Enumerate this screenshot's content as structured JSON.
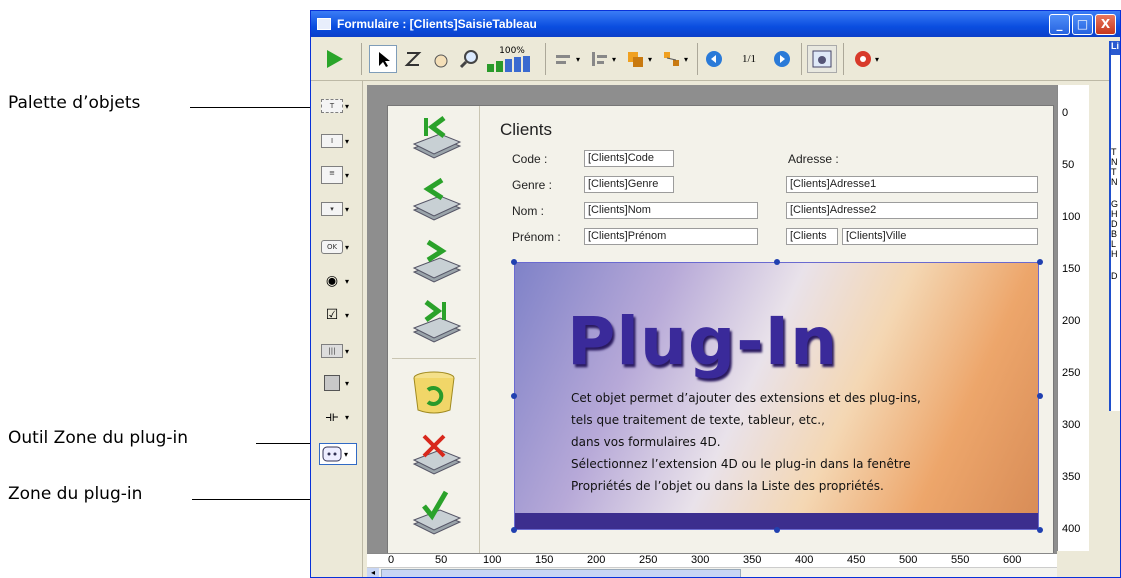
{
  "callouts": {
    "palette": "Palette d’objets",
    "outil": "Outil Zone du plug-in",
    "zone": "Zone du plug-in"
  },
  "window": {
    "title": "Formulaire : [Clients]SaisieTableau",
    "zoom_label": "100%",
    "page_counter": "1/1",
    "minimize": "_",
    "maximize": "□",
    "close": "X"
  },
  "form": {
    "title": "Clients",
    "labels": {
      "code": "Code :",
      "genre": "Genre :",
      "nom": "Nom :",
      "prenom": "Prénom :",
      "adresse": "Adresse :"
    },
    "fields": {
      "code": "[Clients]Code",
      "genre": "[Clients]Genre",
      "nom": "[Clients]Nom",
      "prenom": "[Clients]Prénom",
      "adresse1": "[Clients]Adresse1",
      "adresse2": "[Clients]Adresse2",
      "cp": "[Clients",
      "ville": "[Clients]Ville"
    }
  },
  "plugin_area": {
    "heading": "Plug-In",
    "lines": [
      "Cet objet permet d’ajouter des extensions et des plug-ins,",
      "tels que traitement de texte, tableur, etc.,",
      "dans vos formulaires 4D.",
      "Sélectionnez l’extension 4D ou le plug-in dans la fenêtre",
      "Propriétés de l’objet ou dans la Liste des propriétés."
    ]
  },
  "vruler": [
    "0",
    "50",
    "100",
    "150",
    "200",
    "250",
    "300",
    "350",
    "400"
  ],
  "hruler": [
    "0",
    "50",
    "100",
    "150",
    "200",
    "250",
    "300",
    "350",
    "400",
    "450",
    "500",
    "550",
    "600"
  ],
  "side_panel": {
    "title": "Li",
    "letters": [
      "T",
      "N",
      "T",
      "N",
      "G",
      "H",
      "D",
      "B",
      "L",
      "H",
      "D"
    ]
  },
  "colors": {
    "titlebar": "#0a4ee0",
    "window_bg": "#ece9d8",
    "canvas": "#8e8e8e",
    "plugin_band": "#3c2e8e",
    "plugin_heading": "#3a2a9a"
  },
  "icons": {
    "run": "play-icon",
    "select": "arrow-icon",
    "order": "entry-order-icon",
    "hand": "hand-icon",
    "zoom": "magnifier-icon",
    "bars": "zoom-bars-icon",
    "first": "first-record-icon",
    "prev": "previous-record-icon",
    "next": "next-record-icon",
    "last": "last-record-icon",
    "add": "add-record-icon",
    "delete": "delete-record-icon",
    "validate": "validate-icon"
  }
}
